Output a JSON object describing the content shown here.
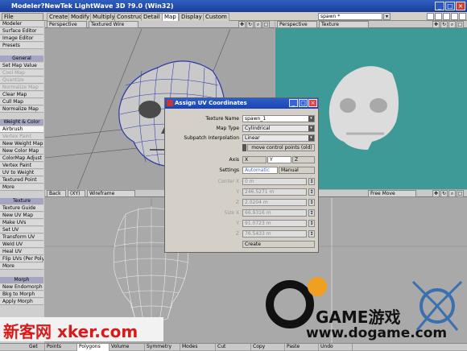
{
  "window": {
    "title": "Modeler?NewTek LightWave 3D ?9.0 (Win32)",
    "min": "_",
    "max": "□",
    "close": "×"
  },
  "menu": {
    "file": "File",
    "tabs": [
      "Create",
      "Modify",
      "Multiply",
      "Construct",
      "Detail",
      "Map",
      "Display",
      "Custom"
    ],
    "active_tab": "Map",
    "layer_select": "spawn *"
  },
  "sidebar": {
    "items": [
      "Modeler",
      "Surface Editor",
      "Image Editor",
      "Presets",
      "General",
      "Set Map Value",
      "Cool Map",
      "Quantize",
      "Normalize Map",
      "Clear Map",
      "Cull Map",
      "Normalize Map",
      "Weight & Color",
      "Airbrush",
      "Vertex Paint",
      "New Weight Map",
      "New Color Map",
      "ColorMap Adjust",
      "Vertex Paint",
      "UV to Weight",
      "Textured Point",
      "More",
      "Texture",
      "Texture Guide",
      "New UV Map",
      "Make UVs",
      "Set UV",
      "Transform UV",
      "Weld UV",
      "Heal UV",
      "Flip UVs (Per Poly)",
      "More",
      "Morph",
      "New Endomorph",
      "Bkg to Morph",
      "Apply Morph"
    ]
  },
  "viewports": {
    "top_left": {
      "view": "Perspective",
      "mode": "Textured Wire"
    },
    "top_right": {
      "view": "Perspective",
      "mode": "Texture"
    },
    "bottom_left": {
      "view": "Back",
      "axis": "(XY)",
      "mode": "Wireframe"
    },
    "bottom_right": {
      "mode": "Free Move"
    }
  },
  "dialog": {
    "title": "Assign UV Coordinates",
    "texture_name_label": "Texture Name",
    "texture_name": "spawn_1",
    "map_type_label": "Map Type",
    "map_type": "Cylindrical",
    "subpatch_label": "Subpatch Interpolation",
    "subpatch": "Linear",
    "move_cp": "move control points (old)",
    "axis_label": "Axis",
    "axis_x": "X",
    "axis_y": "Y",
    "axis_z": "Z",
    "settings_label": "Settings",
    "settings_auto": "Automatic",
    "settings_manual": "Manual",
    "rows": [
      {
        "label": "Center X",
        "value": "0 m"
      },
      {
        "label": "Y",
        "value": "246.5271 m"
      },
      {
        "label": "Z",
        "value": "2.0204 m"
      },
      {
        "label": "Size X",
        "value": "66.9316 m"
      },
      {
        "label": "Y",
        "value": "91.0723 m"
      },
      {
        "label": "Z",
        "value": "76.5433 m"
      }
    ],
    "create": "Create"
  },
  "bottom": {
    "items": [
      "Get",
      "Points",
      "Polygons",
      "Volume",
      "Symmetry",
      "Modes",
      "Cut",
      "Copy",
      "Paste",
      "Undo"
    ]
  },
  "watermark_left": "新客网 xker.com",
  "watermark_right_1": "GAME游戏",
  "watermark_right_2": "www.dogame.com",
  "colors": {
    "viewport_teal": "#3d9a96",
    "title_blue": "#1e48a8",
    "watermark_red": "#d91a1a"
  }
}
